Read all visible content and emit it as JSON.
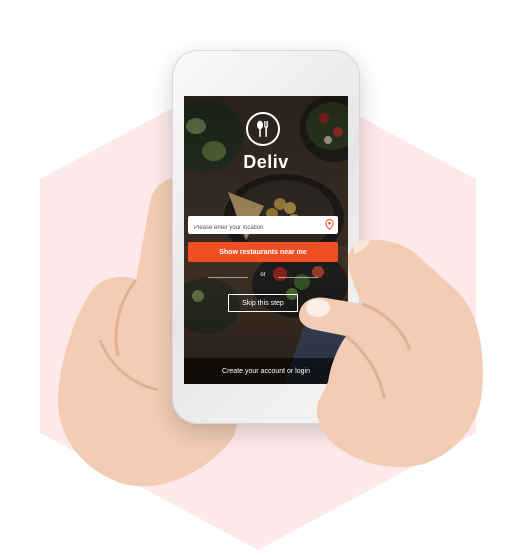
{
  "app": {
    "brand_name": "Deliv",
    "logo_icon": "spoon-fork-icon"
  },
  "location_field": {
    "placeholder": "Please enter your location",
    "value": "",
    "icon": "map-pin-icon"
  },
  "primary_button": {
    "label": "Show restaurants near me"
  },
  "divider": {
    "label": "or"
  },
  "skip_button": {
    "label": "Skip this step"
  },
  "footer": {
    "label": "Create your account or login"
  },
  "colors": {
    "accent": "#f04e23",
    "hexagon_background": "#fde9ea",
    "pin": "#f04e23"
  }
}
